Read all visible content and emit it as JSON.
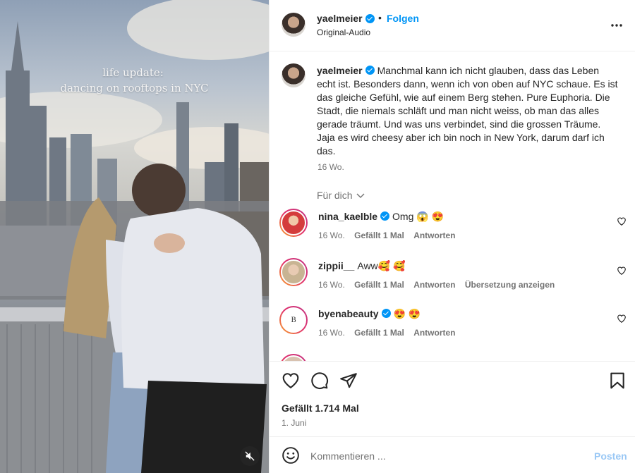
{
  "media": {
    "overlay_line1": "life update:",
    "overlay_line2": "dancing on rooftops in NYC",
    "mute_icon": "speaker-muted-icon"
  },
  "header": {
    "username": "yaelmeier",
    "separator": "•",
    "follow_label": "Folgen",
    "audio_label": "Original-Audio",
    "more_icon": "more-options-icon"
  },
  "caption": {
    "username": "yaelmeier",
    "text": "Manchmal kann ich nicht glauben, dass das Leben echt ist. Besonders dann, wenn ich von oben auf NYC schaue. Es ist das gleiche Gefühl, wie auf einem Berg stehen. Pure Euphoria. Die Stadt, die niemals schläft und man nicht weiss, ob man das alles gerade träumt. Und was uns verbindet, sind die grossen Träume. Jaja es wird cheesy aber ich bin noch in New York, darum darf ich das.",
    "time": "16 Wo."
  },
  "filter": {
    "label": "Für dich"
  },
  "comments": [
    {
      "username": "nina_kaelble",
      "verified": true,
      "text": "Omg 😱 😍",
      "time": "16 Wo.",
      "likes": "Gefällt 1 Mal",
      "reply": "Antworten",
      "translate": ""
    },
    {
      "username": "zippii__",
      "verified": false,
      "text": "Aww🥰 🥰",
      "time": "16 Wo.",
      "likes": "Gefällt 1 Mal",
      "reply": "Antworten",
      "translate": "Übersetzung anzeigen"
    },
    {
      "username": "byenabeauty",
      "verified": true,
      "text": "😍 😍",
      "time": "16 Wo.",
      "likes": "Gefällt 1 Mal",
      "reply": "Antworten",
      "translate": ""
    }
  ],
  "actions": {
    "likes_text": "Gefällt 1.714 Mal",
    "date": "1. Juni"
  },
  "composer": {
    "placeholder": "Kommentieren ...",
    "post_label": "Posten"
  },
  "colors": {
    "accent": "#0095f6",
    "post_disabled": "#9ac8f5",
    "muted_text": "#737373"
  }
}
